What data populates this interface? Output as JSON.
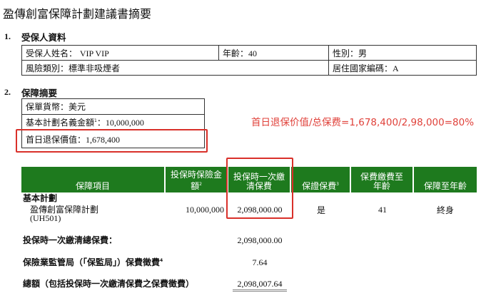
{
  "title": "盈傳創富保障計劃建議書摘要",
  "section1": {
    "num": "1.",
    "heading": "受保人資料",
    "name_label": "受保人姓名：",
    "name": "VIP VIP",
    "age_label": "年齡：",
    "age": "40",
    "gender_label": "性別：",
    "gender": "男",
    "risk_label": "風險類別：",
    "risk": "標準非吸煙者",
    "country_label": "居住國家編碼：",
    "country": "A"
  },
  "section2": {
    "num": "2.",
    "heading": "保障摘要",
    "currency_label": "保單貨幣：",
    "currency": "美元",
    "notional_label": "基本計劃名義金額",
    "notional_sup": "1",
    "notional_colon": "：",
    "notional": "10,000,000",
    "surrender_label": "首日退保價值：",
    "surrender": "1,678,400"
  },
  "annotation": "首日退保价值/总保费=1,678,400/2,98,000=80%",
  "table": {
    "headers": [
      "保障項目",
      "投保時保險金額",
      "投保時一次繳清保費",
      "保證保費",
      "保費繳費至年齡",
      "保障至年齡"
    ],
    "header_sups": [
      "",
      "2",
      "",
      "3",
      "",
      ""
    ],
    "group": "基本計劃",
    "plan_name": "盈傳創富保障計劃",
    "plan_code": "(UH501)",
    "sum_insured": "10,000,000",
    "premium": "2,098,000.00",
    "guaranteed": "是",
    "pay_to_age": "41",
    "cover_to_age": "終身"
  },
  "totals": [
    {
      "label": "投保時一次繳清總保費：",
      "value": "2,098,000.00"
    },
    {
      "label": "保險業監管局（「保監局」）保費徵費",
      "sup": "4",
      "value": "7.64"
    },
    {
      "label": "總額（包括投保時一次繳清保費之保費徵費）",
      "value": "2,098,007.64"
    }
  ],
  "colors": {
    "header_green": "#1e7a1e",
    "highlight_red": "#d9302a"
  }
}
